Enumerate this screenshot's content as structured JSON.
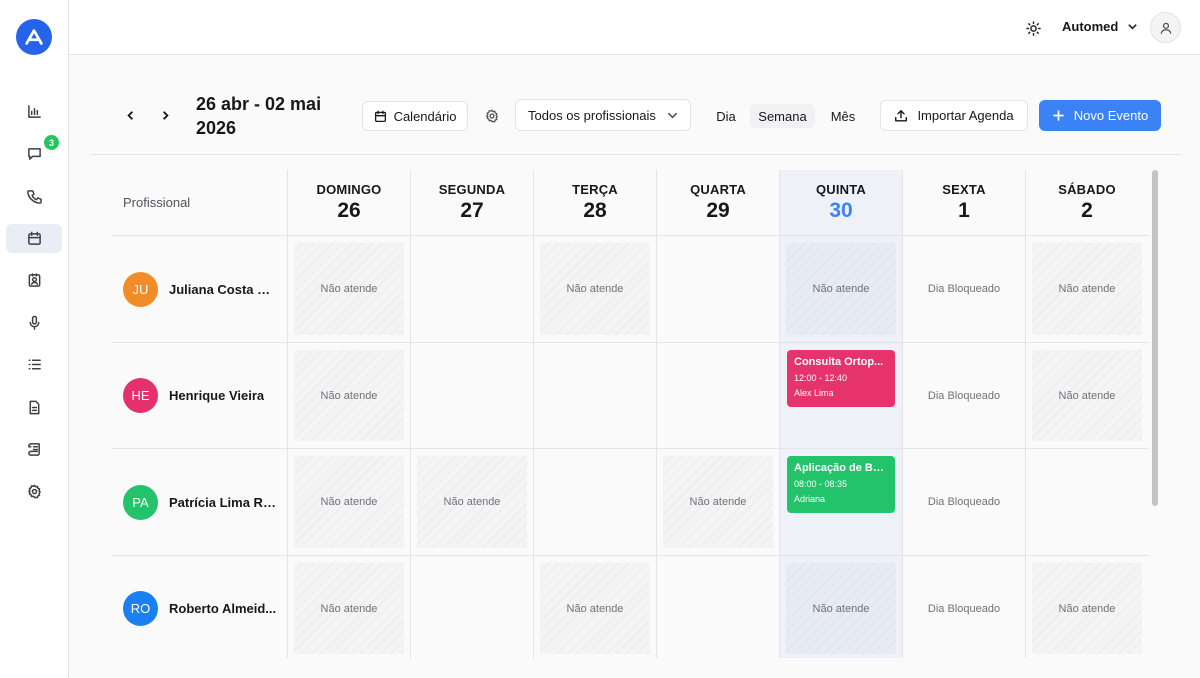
{
  "app": {
    "logo": "automed-logo"
  },
  "sidebar": {
    "items": [
      {
        "icon": "bar-chart-icon",
        "active": false
      },
      {
        "icon": "chat-icon",
        "active": false,
        "badge": "3"
      },
      {
        "icon": "phone-icon",
        "active": false
      },
      {
        "icon": "calendar-icon",
        "active": true
      },
      {
        "icon": "contact-card-icon",
        "active": false
      },
      {
        "icon": "microphone-icon",
        "active": false
      },
      {
        "icon": "list-icon",
        "active": false
      },
      {
        "icon": "document-icon",
        "active": false
      },
      {
        "icon": "scroll-icon",
        "active": false
      },
      {
        "icon": "gear-icon",
        "active": false
      }
    ]
  },
  "topbar": {
    "org_name": "Automed"
  },
  "toolbar": {
    "range_title": "26 abr - 02 mai 2026",
    "calendar_label": "Calendário",
    "professional_select": "Todos os profissionais",
    "views": [
      "Dia",
      "Semana",
      "Mês"
    ],
    "active_view": "Semana",
    "import_label": "Importar Agenda",
    "new_event_label": "Novo Evento"
  },
  "grid": {
    "professional_header": "Profissional",
    "days": [
      {
        "name": "DOMINGO",
        "num": "26",
        "today": false
      },
      {
        "name": "SEGUNDA",
        "num": "27",
        "today": false
      },
      {
        "name": "TERÇA",
        "num": "28",
        "today": false
      },
      {
        "name": "QUARTA",
        "num": "29",
        "today": false
      },
      {
        "name": "QUINTA",
        "num": "30",
        "today": true
      },
      {
        "name": "SEXTA",
        "num": "1",
        "today": false
      },
      {
        "name": "SÁBADO",
        "num": "2",
        "today": false
      }
    ],
    "rows": [
      {
        "initials": "JU",
        "name": "Juliana Costa Br...",
        "color": "#f28c28",
        "cells": [
          {
            "type": "off",
            "text": "Não atende"
          },
          {
            "type": "empty",
            "text": ""
          },
          {
            "type": "off",
            "text": "Não atende"
          },
          {
            "type": "empty",
            "text": ""
          },
          {
            "type": "off",
            "text": "Não atende"
          },
          {
            "type": "blocked",
            "text": "Dia Bloqueado"
          },
          {
            "type": "off",
            "text": "Não atende"
          }
        ]
      },
      {
        "initials": "HE",
        "name": "Henrique Vieira",
        "color": "#e5306c",
        "cells": [
          {
            "type": "off",
            "text": "Não atende"
          },
          {
            "type": "empty",
            "text": ""
          },
          {
            "type": "empty",
            "text": ""
          },
          {
            "type": "empty",
            "text": ""
          },
          {
            "type": "event",
            "text": "",
            "event": {
              "title": "Consulta Ortop...",
              "time": "12:00 - 12:40",
              "person": "Alex Lima",
              "color": "#e7336d"
            }
          },
          {
            "type": "blocked",
            "text": "Dia Bloqueado"
          },
          {
            "type": "off",
            "text": "Não atende"
          }
        ]
      },
      {
        "initials": "PA",
        "name": "Patrícia Lima Ro...",
        "color": "#22c36b",
        "cells": [
          {
            "type": "off",
            "text": "Não atende"
          },
          {
            "type": "off",
            "text": "Não atende"
          },
          {
            "type": "empty",
            "text": ""
          },
          {
            "type": "off",
            "text": "Não atende"
          },
          {
            "type": "event",
            "text": "",
            "event": {
              "title": "Aplicação de Bo...",
              "time": "08:00 - 08:35",
              "person": "Adriana",
              "color": "#22c36b"
            }
          },
          {
            "type": "blocked",
            "text": "Dia Bloqueado"
          },
          {
            "type": "empty",
            "text": ""
          }
        ]
      },
      {
        "initials": "RO",
        "name": "Roberto Almeid...",
        "color": "#1a7ff0",
        "cells": [
          {
            "type": "off",
            "text": "Não atende"
          },
          {
            "type": "empty",
            "text": ""
          },
          {
            "type": "off",
            "text": "Não atende"
          },
          {
            "type": "empty",
            "text": ""
          },
          {
            "type": "off",
            "text": "Não atende"
          },
          {
            "type": "blocked",
            "text": "Dia Bloqueado"
          },
          {
            "type": "off",
            "text": "Não atende"
          }
        ]
      }
    ]
  },
  "colors": {
    "accent": "#3b82f6",
    "today_bg": "#eef2f8"
  }
}
